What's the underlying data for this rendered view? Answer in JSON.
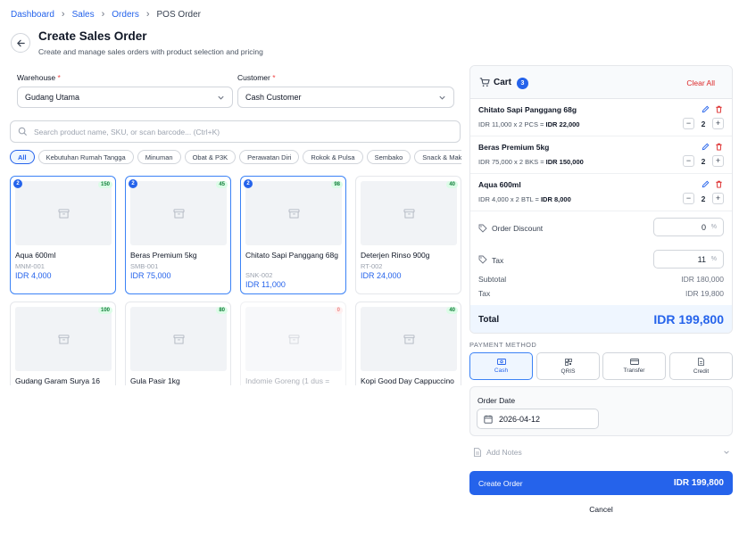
{
  "breadcrumb": {
    "items": [
      "Dashboard",
      "Sales",
      "Orders"
    ],
    "current": "POS Order"
  },
  "header": {
    "title": "Create Sales Order",
    "subtitle": "Create and manage sales orders with product selection and pricing"
  },
  "filters": {
    "warehouse_label": "Warehouse",
    "warehouse_value": "Gudang Utama",
    "customer_label": "Customer",
    "customer_value": "Cash Customer",
    "required_mark": "*"
  },
  "search": {
    "placeholder": "Search product name, SKU, or scan barcode... (Ctrl+K)"
  },
  "categories": [
    "All",
    "Kebutuhan Rumah Tangga",
    "Minuman",
    "Obat & P3K",
    "Perawatan Diri",
    "Rokok & Pulsa",
    "Sembako",
    "Snack & Makanan"
  ],
  "products": [
    {
      "name": "Aqua 600ml",
      "sku": "MNM-001",
      "price": "IDR 4,000",
      "stock": "150",
      "qty": "2"
    },
    {
      "name": "Beras Premium 5kg",
      "sku": "SMB-001",
      "price": "IDR 75,000",
      "stock": "45",
      "qty": "2"
    },
    {
      "name": "Chitato Sapi Panggang 68g",
      "sku": "SNK-002",
      "price": "IDR 11,000",
      "stock": "98",
      "qty": "2"
    },
    {
      "name": "Deterjen Rinso 900g",
      "sku": "RT-002",
      "price": "IDR 24,000",
      "stock": "40"
    },
    {
      "name": "Gudang Garam Surya 16",
      "stock": "100"
    },
    {
      "name": "Gula Pasir 1kg",
      "stock": "80"
    },
    {
      "name": "Indomie Goreng (1 dus =",
      "stock": "0"
    },
    {
      "name": "Kopi Good Day Cappuccino",
      "stock": "40"
    }
  ],
  "cart": {
    "title": "Cart",
    "count": "3",
    "clear_label": "Clear All",
    "items": [
      {
        "name": "Chitato Sapi Panggang 68g",
        "detail": "IDR 11,000 x 2 PCS = ",
        "line_total": "IDR 22,000",
        "qty": "2"
      },
      {
        "name": "Beras Premium 5kg",
        "detail": "IDR 75,000 x 2 BKS = ",
        "line_total": "IDR 150,000",
        "qty": "2"
      },
      {
        "name": "Aqua 600ml",
        "detail": "IDR 4,000 x 2 BTL = ",
        "line_total": "IDR 8,000",
        "qty": "2"
      }
    ],
    "discount_label": "Order Discount",
    "discount_value": "0",
    "tax_label": "Tax",
    "tax_value": "11",
    "percent": "%",
    "subtotal_label": "Subtotal",
    "subtotal_value": "IDR 180,000",
    "tax_row_label": "Tax",
    "tax_row_value": "IDR 19,800",
    "total_label": "Total",
    "total_value": "IDR 199,800"
  },
  "payment": {
    "label": "PAYMENT METHOD",
    "methods": [
      "Cash",
      "QRIS",
      "Transfer",
      "Credit"
    ]
  },
  "order_date": {
    "label": "Order Date",
    "value": "2026-04-12"
  },
  "notes": {
    "label": "Add Notes"
  },
  "actions": {
    "create_label": "Create Order",
    "create_total": "IDR 199,800",
    "cancel_label": "Cancel"
  },
  "colors": {
    "accent": "#2563eb",
    "danger": "#dc2626",
    "stock_ok": "#15803d"
  }
}
